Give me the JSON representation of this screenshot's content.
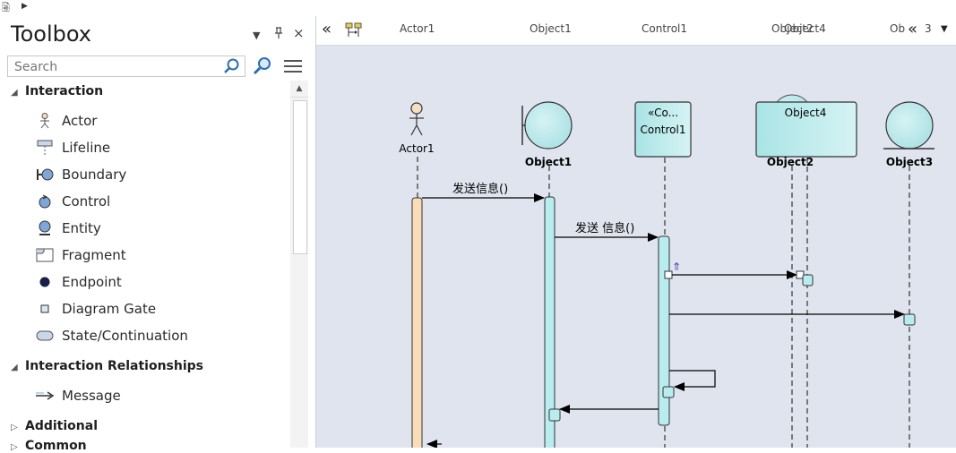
{
  "toolbox": {
    "title": "Toolbox",
    "search_placeholder": "Search",
    "sections": {
      "interaction": {
        "label": "Interaction",
        "items": [
          "Actor",
          "Lifeline",
          "Boundary",
          "Control",
          "Entity",
          "Fragment",
          "Endpoint",
          "Diagram Gate",
          "State/Continuation"
        ]
      },
      "relationships": {
        "label": "Interaction Relationships",
        "items": [
          "Message"
        ]
      },
      "additional": {
        "label": "Additional"
      },
      "common": {
        "label": "Common"
      }
    }
  },
  "diagram": {
    "header": [
      "Actor1",
      "Object1",
      "Control1",
      "Object2",
      "Object4",
      "Ob",
      "3"
    ],
    "actor_label": "Actor1",
    "object1_label": "Object1",
    "control_stereotype": "«Co...",
    "control_label": "Control1",
    "object4_label": "Object4",
    "object2_label": "Object2",
    "object3_label": "Object3",
    "msg1": "发送信息()",
    "msg2": "发送 信息()",
    "mark": "⇑"
  }
}
